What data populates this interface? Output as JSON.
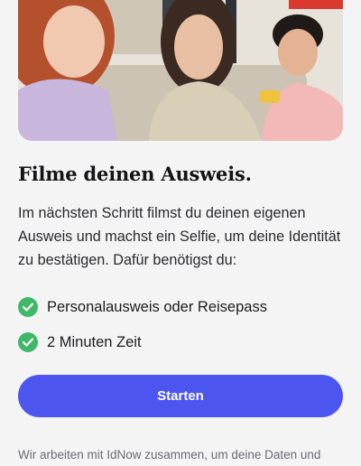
{
  "hero": {
    "image_name": "family-photo"
  },
  "content": {
    "title": "Filme deinen Ausweis.",
    "description": "Im nächsten Schritt filmst du deinen eigenen Ausweis und machst ein Selfie, um deine Identität zu bestätigen. Dafür benötigst du:",
    "requirements": [
      {
        "label": "Personalausweis oder Reisepass",
        "icon": "check-circle-icon"
      },
      {
        "label": "2 Minuten Zeit",
        "icon": "check-circle-icon"
      }
    ],
    "start_button_label": "Starten",
    "footer_note": "Wir arbeiten mit IdNow zusammen, um deine Daten und"
  },
  "colors": {
    "accent": "#4c55f0",
    "check_green": "#3fb868",
    "background": "#f4f4f5"
  }
}
